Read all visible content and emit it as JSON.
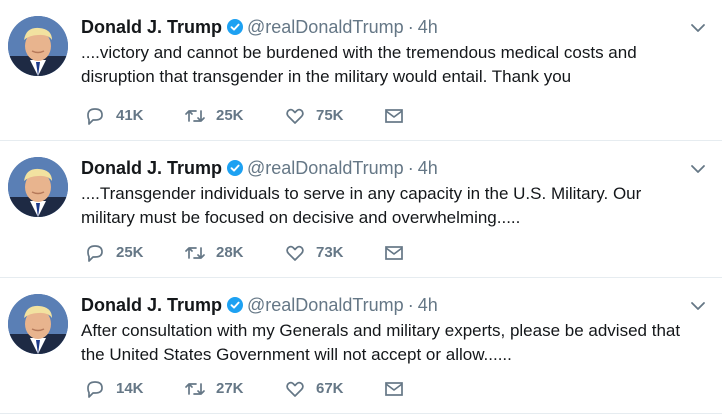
{
  "tweets": [
    {
      "author_name": "Donald J. Trump",
      "handle": "@realDonaldTrump",
      "dot": "·",
      "time": "4h",
      "text_lines": [
        "....victory and cannot be burdened with the tremendous medical costs and",
        "disruption that transgender in the military would entail. Thank you"
      ],
      "replies": "41K",
      "retweets": "25K",
      "likes": "75K"
    },
    {
      "author_name": "Donald J. Trump",
      "handle": "@realDonaldTrump",
      "dot": "·",
      "time": "4h",
      "text_lines": [
        "....Transgender individuals to  serve in any capacity in the U.S. Military. Our",
        "military must be focused on decisive and overwhelming....."
      ],
      "replies": "25K",
      "retweets": "28K",
      "likes": "73K"
    },
    {
      "author_name": "Donald J. Trump",
      "handle": "@realDonaldTrump",
      "dot": "·",
      "time": "4h",
      "text_lines": [
        "After consultation with my Generals and military experts, please be advised that",
        "the United States Government will not accept or allow......"
      ],
      "replies": "14K",
      "retweets": "27K",
      "likes": "67K"
    }
  ],
  "icons": {
    "avatar": "profile-photo",
    "verified": "verified-badge-icon",
    "more": "chevron-down-icon",
    "reply": "reply-icon",
    "retweet": "retweet-icon",
    "like": "heart-icon",
    "message": "envelope-icon"
  },
  "colors": {
    "name": "#14171a",
    "secondary": "#657786",
    "verified": "#1da1f2",
    "divider": "#e6ecf0"
  }
}
